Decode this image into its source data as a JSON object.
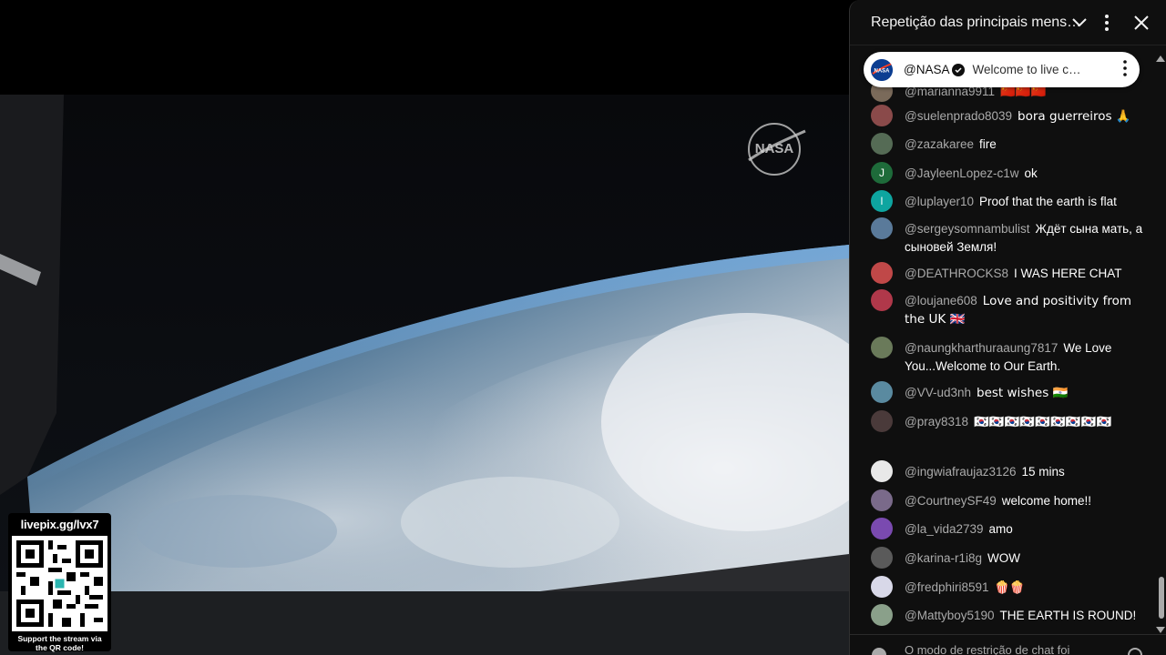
{
  "video": {
    "qr": {
      "url": "livepix.gg/lvx7",
      "caption": "Support the stream via the QR code!"
    },
    "logo_text": "NASA"
  },
  "chat": {
    "title": "Repetição das principais mens…",
    "pinned": {
      "author": "@NASA",
      "text": "Welcome to live c…"
    },
    "messages": [
      {
        "author": "@marianna9911",
        "text": "🇨🇳🇨🇳🇨🇳",
        "avatar_color": "#7a6a5a",
        "avatar_initial": ""
      },
      {
        "author": "@suelenprado8039",
        "text": "bora guerreiros 🙏",
        "avatar_color": "#8a4a4a",
        "avatar_initial": ""
      },
      {
        "author": "@zazakaree",
        "text": "fire",
        "avatar_color": "#556b55",
        "avatar_initial": ""
      },
      {
        "author": "@JayleenLopez-c1w",
        "text": "ok",
        "avatar_color": "#1e6b3a",
        "avatar_initial": "J"
      },
      {
        "author": "@luplayer10",
        "text": "Proof that the earth is flat",
        "avatar_color": "#0ea5a0",
        "avatar_initial": "l"
      },
      {
        "author": "@sergeysomnambulist",
        "text": "Ждёт сына мать, а сыновей Земля!",
        "avatar_color": "#5a7a9a",
        "avatar_initial": ""
      },
      {
        "author": "@DEATHROCKS8",
        "text": "I WAS HERE CHAT",
        "avatar_color": "#c04848",
        "avatar_initial": ""
      },
      {
        "author": "@loujane608",
        "text": "Love and positivity from the UK 🇬🇧",
        "avatar_color": "#b0384a",
        "avatar_initial": ""
      },
      {
        "author": "@naungkharthuraaung7817",
        "text": "We Love You...Welcome to Our Earth.",
        "avatar_color": "#6a7a5a",
        "avatar_initial": ""
      },
      {
        "author": "@VV-ud3nh",
        "text": "best wishes 🇮🇳",
        "avatar_color": "#5a8aa0",
        "avatar_initial": ""
      },
      {
        "author": "@pray8318",
        "text": "🇰🇷🇰🇷🇰🇷🇰🇷🇰🇷🇰🇷🇰🇷🇰🇷🇰🇷",
        "avatar_color": "#4a3a3a",
        "avatar_initial": ""
      },
      {
        "author": "@ingwiafraujaz3126",
        "text": "15 mins",
        "avatar_color": "#e8e8e8",
        "avatar_initial": ""
      },
      {
        "author": "@CourtneySF49",
        "text": "welcome home!!",
        "avatar_color": "#7a6a8a",
        "avatar_initial": ""
      },
      {
        "author": "@la_vida2739",
        "text": "amo",
        "avatar_color": "#7a4ab0",
        "avatar_initial": ""
      },
      {
        "author": "@karina-r1i8g",
        "text": "WOW",
        "avatar_color": "#5a5a5a",
        "avatar_initial": ""
      },
      {
        "author": "@fredphiri8591",
        "text": "🍿🍿",
        "avatar_color": "#d8d8e8",
        "avatar_initial": ""
      },
      {
        "author": "@Mattyboy5190",
        "text": "THE EARTH IS ROUND!",
        "avatar_color": "#8aa08a",
        "avatar_initial": ""
      }
    ],
    "footer_text": "O modo de restrição de chat foi"
  },
  "colors": {
    "chat_bg": "#0f0f0f",
    "author": "#aaaaaa",
    "pinned_bg": "#ffffff"
  }
}
